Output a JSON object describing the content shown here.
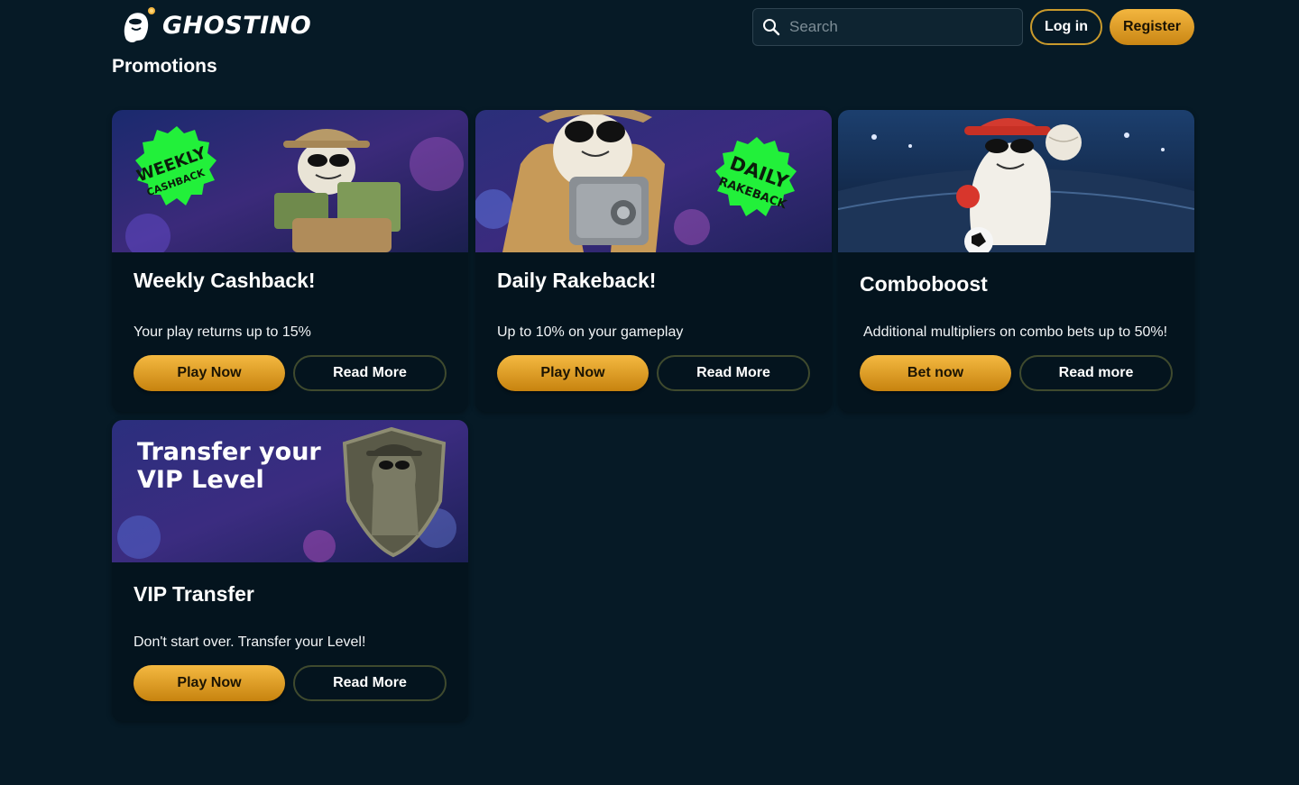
{
  "header": {
    "brand": "GHOSTINO",
    "search": {
      "placeholder": "Search",
      "icon": "search-icon"
    },
    "login_label": "Log in",
    "register_label": "Register"
  },
  "page": {
    "title": "Promotions"
  },
  "colors": {
    "background": "#061a26",
    "card": "#04141e",
    "accent_gold": "#e1a52a",
    "badge_green": "#22f03a"
  },
  "promotions": [
    {
      "title": "Weekly Cashback!",
      "description": "Your play returns up to 15%",
      "primary_label": "Play Now",
      "secondary_label": "Read More",
      "banner": {
        "line1": "WEEKLY",
        "line2": "CASHBACK"
      }
    },
    {
      "title": "Daily Rakeback!",
      "description": "Up to 10% on your gameplay",
      "primary_label": "Play Now",
      "secondary_label": "Read More",
      "banner": {
        "line1": "DAILY",
        "line2": "RAKEBACK"
      }
    },
    {
      "title": "Comboboost",
      "description": "Additional multipliers on combo bets up to 50%!",
      "primary_label": "Bet now",
      "secondary_label": "Read more"
    },
    {
      "title": "VIP Transfer",
      "description": "Don't start over. Transfer your Level!",
      "primary_label": "Play Now",
      "secondary_label": "Read More",
      "banner": {
        "line1": "Transfer your",
        "line2": "VIP Level"
      }
    }
  ]
}
